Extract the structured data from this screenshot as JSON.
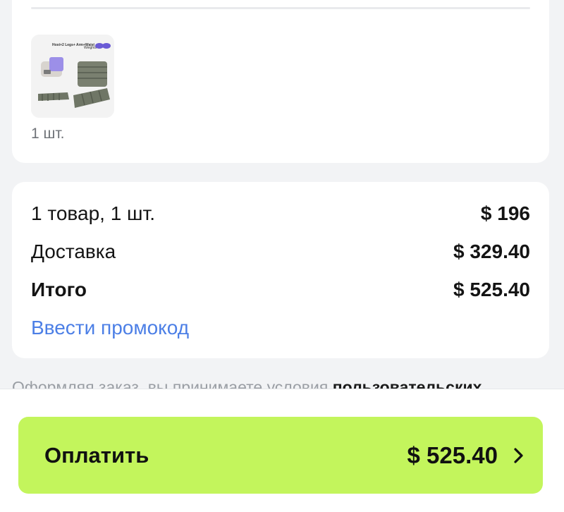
{
  "items": {
    "thumbnail": {
      "caption_top": "Host+2 Legs+ Arm+Waist",
      "caption_right": "Weights"
    },
    "quantity": "1 шт."
  },
  "summary": {
    "items_label": "1 товар, 1 шт.",
    "items_value": "$ 196",
    "delivery_label": "Доставка",
    "delivery_value": "$ 329.40",
    "total_label": "Итого",
    "total_value": "$ 525.40",
    "promo_link": "Ввести промокод"
  },
  "terms": {
    "text": "Оформляя заказ, вы принимаете условия ",
    "link": "пользовательских"
  },
  "footer": {
    "pay_label": "Оплатить",
    "pay_total": "$ 525.40"
  },
  "colors": {
    "accent_button": "#c3f55c",
    "link": "#4c7fe6",
    "background": "#f2f3f5"
  }
}
